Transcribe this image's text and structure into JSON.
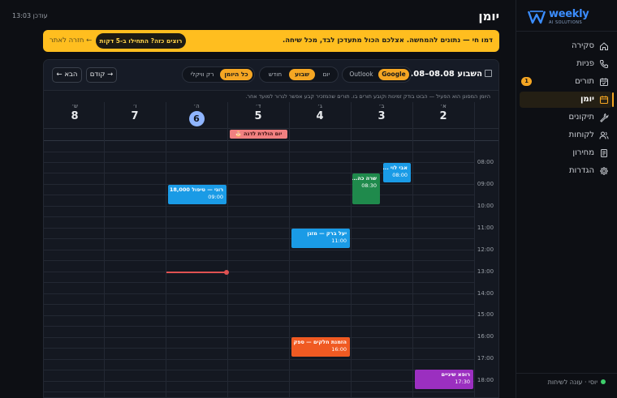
{
  "app": {
    "logo_text": "weekly",
    "logo_sub": "AI SOLUTIONS",
    "page_title": "יומן",
    "updated": "עודכן 13:03"
  },
  "sidebar": {
    "items": [
      {
        "label": "סקירה",
        "icon": "home-icon"
      },
      {
        "label": "פניות",
        "icon": "phone-icon"
      },
      {
        "label": "תורים",
        "icon": "calendar-check-icon",
        "badge": "1"
      },
      {
        "label": "יומן",
        "icon": "calendar-icon",
        "active": true
      },
      {
        "label": "תיקונים",
        "icon": "wrench-icon"
      },
      {
        "label": "לקוחות",
        "icon": "users-icon"
      },
      {
        "label": "מחירון",
        "icon": "price-list-icon"
      },
      {
        "label": "הגדרות",
        "icon": "gear-icon"
      }
    ],
    "status": "יוסי · עונה לשיחות",
    "status_color": "#3ecf6b"
  },
  "banner": {
    "text": "דמו חי — נתונים להמחשה. אצלכם הכול מתעדכן לבד, מכל שיחה.",
    "cta": "רוצים כזה? התחילו ב-5 דקות",
    "back": "← חזרה לאתר",
    "color": "#ffbe1f"
  },
  "calendar": {
    "week_range": "02.08–08.08 השבוע",
    "sources": [
      "Google",
      "Outlook"
    ],
    "active_source": "Google",
    "views": [
      "יום",
      "שבוע",
      "חודש"
    ],
    "active_view": "שבוע",
    "filters": [
      "כל היומן",
      "רק וויקלי"
    ],
    "active_filter": "כל היומן",
    "prev_label": "→ קודם",
    "next_label": "הבא ←",
    "hint": "היומן המסונן הוא הפעיל — הבוט בודק זמינות וקובע תורים בו. תורים שהמזכיר קבע אפשר לגרור למועד אחר.",
    "days": [
      {
        "name": "א׳",
        "num": "2"
      },
      {
        "name": "ב׳",
        "num": "3"
      },
      {
        "name": "ג׳",
        "num": "4"
      },
      {
        "name": "ד׳",
        "num": "5"
      },
      {
        "name": "ה׳",
        "num": "6",
        "today": true
      },
      {
        "name": "ו׳",
        "num": "7"
      },
      {
        "name": "ש׳",
        "num": "8"
      }
    ],
    "hours": [
      "08:00",
      "09:00",
      "10:00",
      "11:00",
      "12:00",
      "13:00",
      "14:00",
      "15:00",
      "16:00",
      "17:00",
      "18:00"
    ],
    "all_day_event": {
      "title": "יום הולדת לדנה 🎂",
      "day": "ד׳"
    },
    "events": [
      {
        "title": "אבי לוי ...",
        "time": "08:00",
        "day": "ב׳",
        "color": "#1a9be6"
      },
      {
        "title": "שרה כה...",
        "time": "08:30",
        "day": "ב׳",
        "color": "#1f8a4c"
      },
      {
        "title": "רוני — טיפול 18,000",
        "time": "09:00",
        "day": "ה׳",
        "color": "#1a9be6"
      },
      {
        "title": "יעל ברק — מזגן",
        "time": "11:00",
        "day": "ג׳",
        "color": "#1a9be6"
      },
      {
        "title": "הזמנת חלקים — ספק",
        "time": "16:00",
        "day": "ג׳",
        "color": "#f05a22"
      },
      {
        "title": "רופא שיניים",
        "time": "17:30",
        "day": "א׳",
        "color": "#9b2fc0"
      }
    ],
    "now_time": "13:00"
  }
}
